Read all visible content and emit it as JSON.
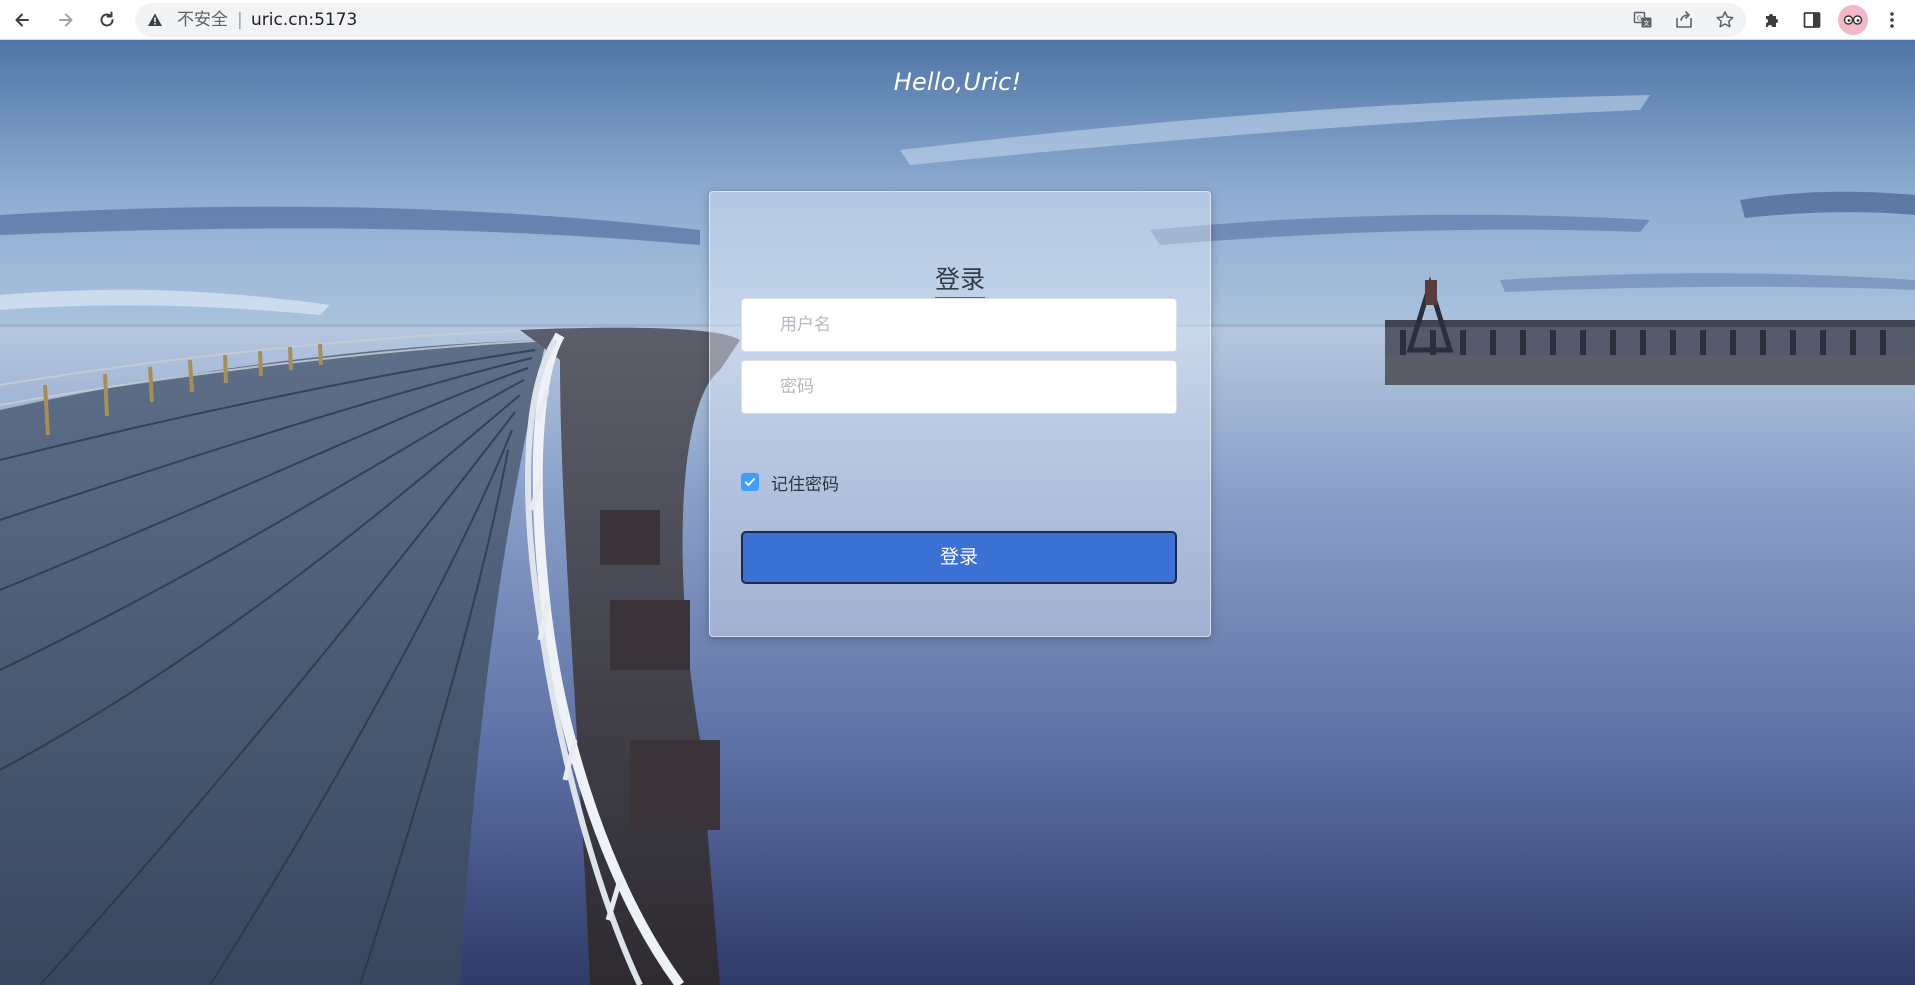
{
  "browser": {
    "security_label": "不安全",
    "separator": "|",
    "url": "uric.cn:5173"
  },
  "page": {
    "greeting": "Hello,Uric!"
  },
  "login": {
    "title": "登录",
    "username_placeholder": "用户名",
    "password_placeholder": "密码",
    "remember_label": "记住密码",
    "remember_checked": true,
    "submit_label": "登录"
  },
  "colors": {
    "primary_button": "#3b71d4",
    "checkbox": "#409eff",
    "title_underline": "#3a6fcf"
  },
  "icons": {
    "back": "back-arrow-icon",
    "forward": "forward-arrow-icon",
    "reload": "reload-icon",
    "warning": "warning-icon",
    "translate": "translate-icon",
    "share": "share-icon",
    "bookmark": "star-icon",
    "extensions": "puzzle-icon",
    "side_panel": "side-panel-icon",
    "profile": "avatar",
    "menu": "kebab-menu-icon"
  }
}
